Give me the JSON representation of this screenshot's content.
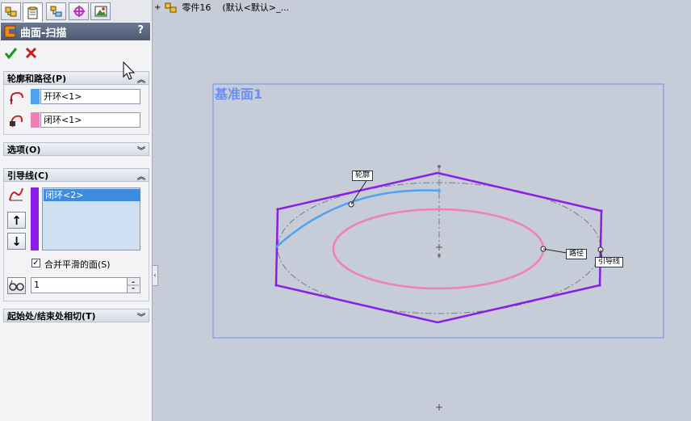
{
  "feature_tree": {
    "part_name": "零件16",
    "config": "(默认<默认>_..."
  },
  "property_manager": {
    "title": "曲面-扫描",
    "help": "?",
    "sections": {
      "profile_path": {
        "title": "轮廓和路径(P)",
        "profile_value": "开环<1>",
        "path_value": "闭环<1>"
      },
      "options": {
        "title": "选项(O)"
      },
      "guides": {
        "title": "引导线(C)",
        "list": [
          "闭环<2>"
        ],
        "merge_label": "合并平滑的面(S)",
        "merge_checked": "✓",
        "spin_value": "1"
      },
      "tangency": {
        "title": "起始处/结束处相切(T)"
      }
    }
  },
  "viewport": {
    "plane_label": "基准面1",
    "callouts": {
      "profile": "轮廓",
      "path": "路径",
      "guide": "引导线"
    }
  },
  "colors": {
    "profile": "#4da3f0",
    "path": "#f07fb8",
    "guide": "#8a1ee6",
    "plane": "#6a8ff0",
    "title_bar": "#5b6780"
  }
}
